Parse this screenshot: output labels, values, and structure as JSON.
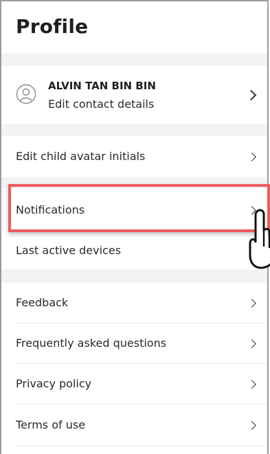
{
  "header": {
    "title": "Profile"
  },
  "profile": {
    "name": "ALVIN TAN BIN BIN",
    "subtitle": "Edit contact details"
  },
  "menu": {
    "edit_child": "Edit child avatar initials",
    "notifications": "Notifications",
    "last_active": "Last active devices",
    "feedback": "Feedback",
    "faq": "Frequently asked questions",
    "privacy": "Privacy policy",
    "terms": "Terms of use"
  },
  "colors": {
    "highlight": "#ee5a5f",
    "gap": "#f3f3f3"
  }
}
